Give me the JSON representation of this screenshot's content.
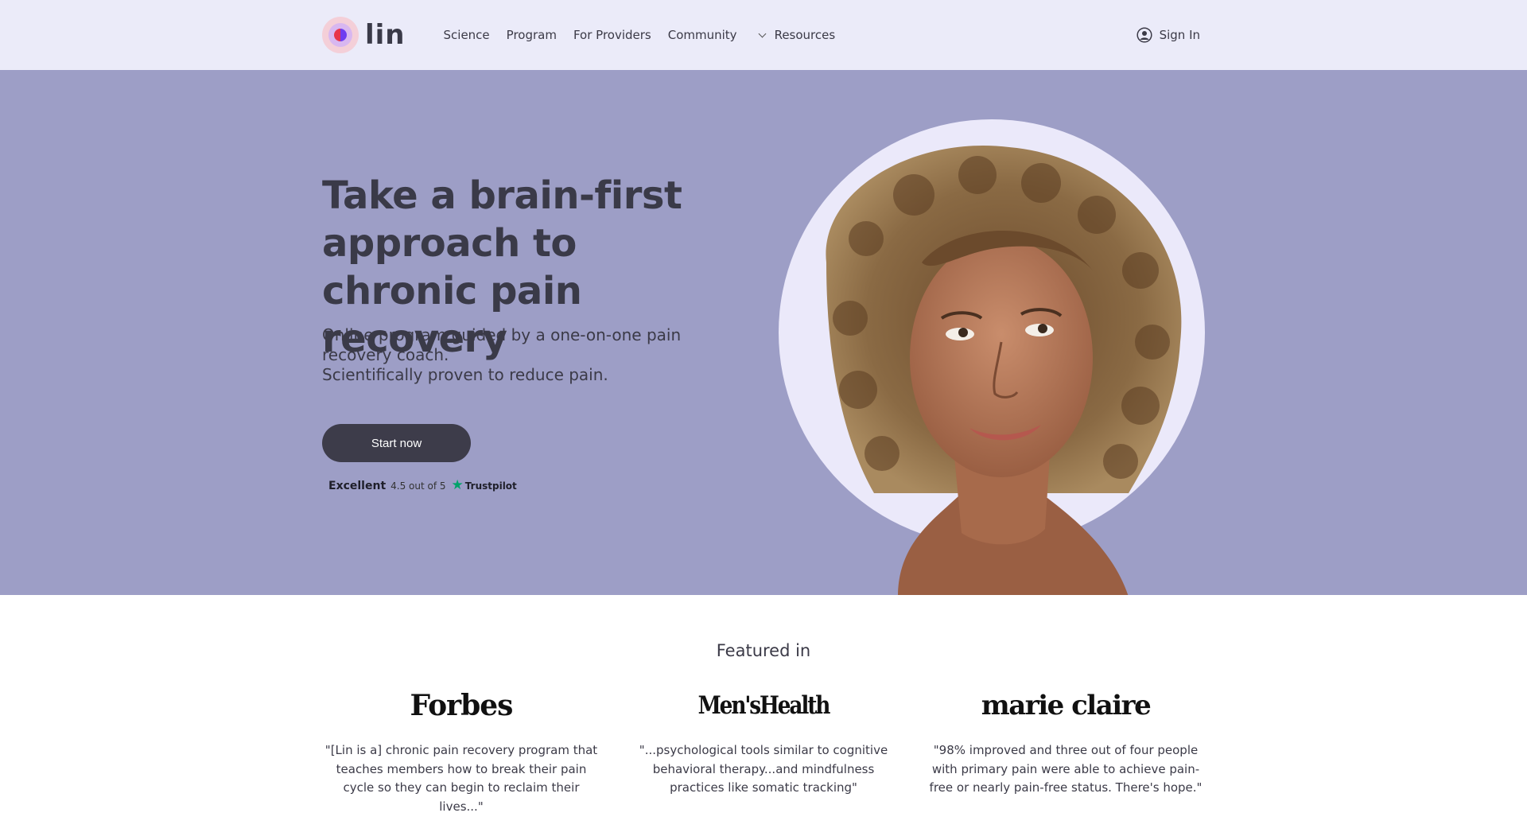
{
  "nav": {
    "logo_text": "lin",
    "items": [
      {
        "label": "Science"
      },
      {
        "label": "Program"
      },
      {
        "label": "For Providers"
      },
      {
        "label": "Community"
      },
      {
        "label": "Resources"
      }
    ],
    "signin_label": "Sign In"
  },
  "hero": {
    "title": "Take a brain-first approach to chronic pain recovery",
    "subtitle_line1": "Online program guided by a one-on-one pain recovery coach.",
    "subtitle_line2": "Scientifically proven to reduce pain.",
    "cta_label": "Start now",
    "trustpilot": {
      "rating_word": "Excellent",
      "score_text": "4.5 out of 5",
      "brand": "Trustpilot"
    }
  },
  "featured": {
    "title": "Featured in",
    "publications": [
      {
        "name": "Forbes",
        "quote": "\"[Lin is a] chronic pain recovery program that teaches members how to break their pain cycle so they can begin to reclaim their lives...\""
      },
      {
        "name": "Men'sHealth",
        "quote": "\"...psychological tools similar to cognitive behavioral therapy...and mindfulness practices like somatic tracking\""
      },
      {
        "name": "marie claire",
        "quote": "\"98% improved and three out of four people with primary pain were able to achieve pain-free or nearly pain-free status. There's hope.\""
      }
    ]
  },
  "colors": {
    "nav_bg": "#ebebf9",
    "hero_bg": "#9d9ec6",
    "cta_bg": "#3d3c4a",
    "trustpilot_green": "#00a26a"
  },
  "icons": {
    "signin": "user-circle-icon",
    "resources": "chevron-down-icon",
    "trustpilot": "star-icon"
  }
}
